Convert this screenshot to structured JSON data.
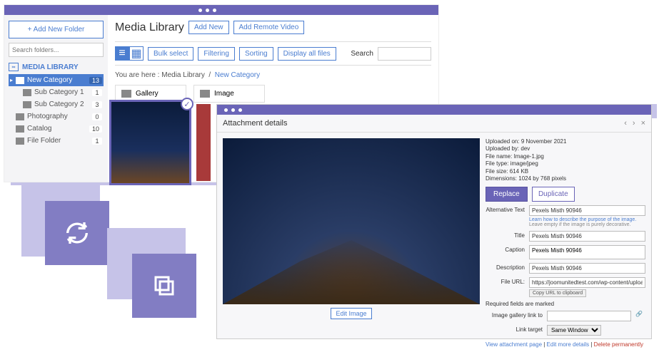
{
  "sidebar": {
    "add_folder": "+  Add New Folder",
    "search_placeholder": "Search folders...",
    "library_label": "MEDIA LIBRARY",
    "items": [
      {
        "label": "New Category",
        "count": "13",
        "active": true
      },
      {
        "label": "Sub Category 1",
        "count": "1"
      },
      {
        "label": "Sub Category 2",
        "count": "3"
      },
      {
        "label": "Photography",
        "count": "0"
      },
      {
        "label": "Catalog",
        "count": "10"
      },
      {
        "label": "File Folder",
        "count": "1"
      }
    ]
  },
  "header": {
    "title": "Media Library",
    "add_new": "Add New",
    "add_remote": "Add Remote Video"
  },
  "toolbar": {
    "bulk": "Bulk select",
    "filtering": "Filtering",
    "sorting": "Sorting",
    "display_all": "Display all files",
    "search_label": "Search"
  },
  "breadcrumb": {
    "prefix": "You are here  :",
    "root": "Media Library",
    "sep": "/",
    "current": "New Category"
  },
  "folder_cards": [
    "Gallery",
    "Image"
  ],
  "thumb_check": "✓",
  "modal": {
    "title": "Attachment details",
    "nav_prev": "‹",
    "nav_next": "›",
    "nav_close": "×",
    "meta": {
      "uploaded_on": "Uploaded on: 9 November 2021",
      "uploaded_by": "Uploaded by: dev",
      "filename": "File name: Image-1.jpg",
      "filetype": "File type: image/jpeg",
      "filesize": "File size: 614 KB",
      "dimensions": "Dimensions: 1024 by 768 pixels"
    },
    "btn_replace": "Replace",
    "btn_duplicate": "Duplicate",
    "labels": {
      "alt": "Alternative Text",
      "title": "Title",
      "caption": "Caption",
      "description": "Description",
      "fileurl": "File URL:",
      "gallery_link": "Image gallery link to",
      "link_target": "Link target"
    },
    "values": {
      "alt": "Pexels Misth 90946",
      "title": "Pexels Misth 90946",
      "caption": "Pexels Misth 90946",
      "description": "Pexels Misth 90946",
      "fileurl": "https://joomunitedtest.com/wp-content/uploads"
    },
    "hint_learn": "Learn how to describe the purpose of the image.",
    "hint_rest": "Leave empty if the image is purely decorative.",
    "copy_url": "Copy URL to clipboard",
    "required_note": "Required fields are marked",
    "link_target_value": "Same Window",
    "edit_image": "Edit Image",
    "view_link": "View attachment page",
    "edit_more": "Edit more details",
    "delete": "Delete permanently",
    "link_icon": "🔗"
  }
}
